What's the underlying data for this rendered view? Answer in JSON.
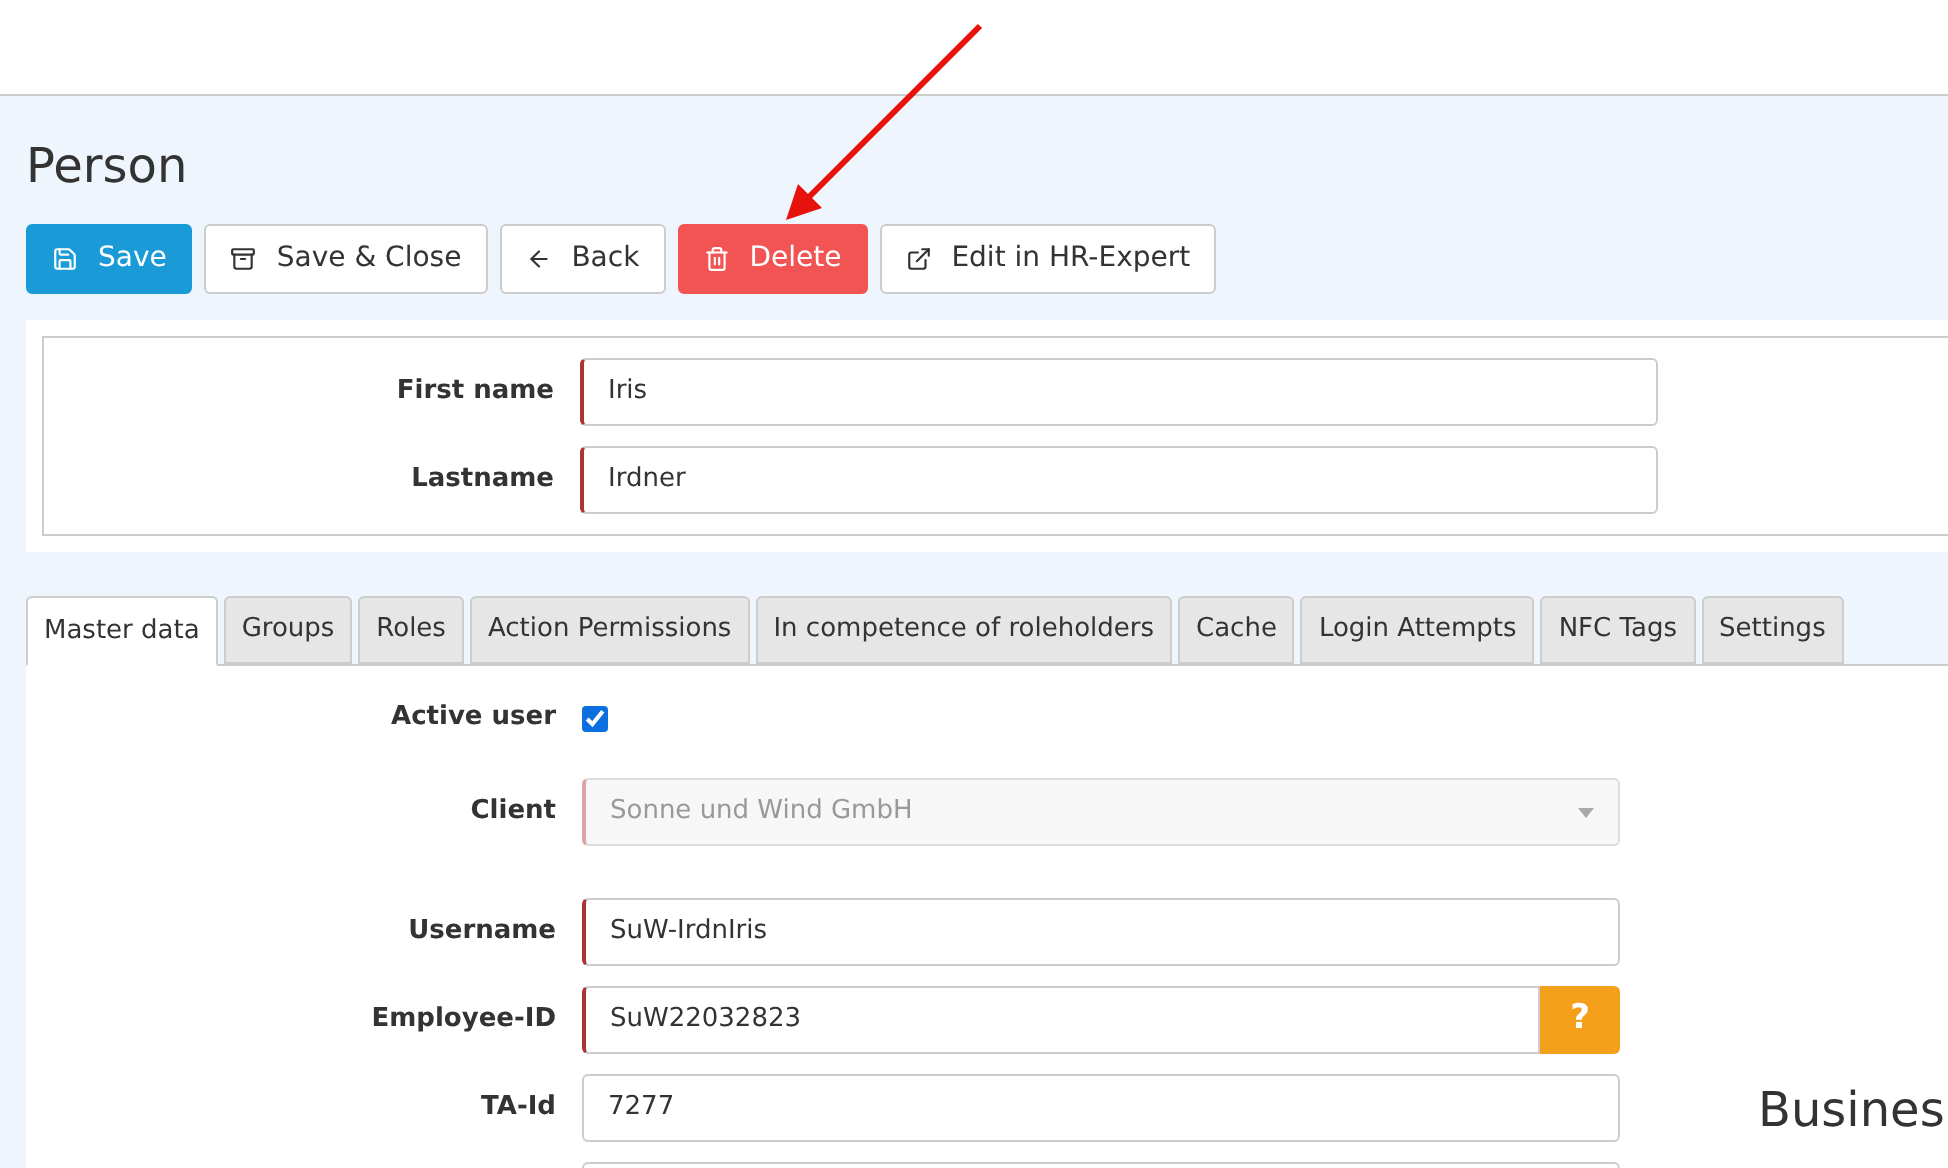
{
  "page": {
    "title": "Person"
  },
  "toolbar": [
    {
      "label": "Save",
      "kind": "primary"
    },
    {
      "label": "Save & Close",
      "kind": "archive"
    },
    {
      "label": "Back",
      "kind": "back"
    },
    {
      "label": "Delete",
      "kind": "danger"
    },
    {
      "label": "Edit in HR-Expert",
      "kind": "external"
    }
  ],
  "name_fields": [
    {
      "label": "First name",
      "value": "Iris",
      "required": true
    },
    {
      "label": "Lastname",
      "value": "Irdner",
      "required": true
    }
  ],
  "tabs": [
    {
      "label": "Master data",
      "selected": true
    },
    {
      "label": "Groups",
      "selected": false
    },
    {
      "label": "Roles",
      "selected": false
    },
    {
      "label": "Action Permissions",
      "selected": false
    },
    {
      "label": "In competence of roleholders",
      "selected": false
    },
    {
      "label": "Cache",
      "selected": false
    },
    {
      "label": "Login Attempts",
      "selected": false
    },
    {
      "label": "NFC Tags",
      "selected": false
    },
    {
      "label": "Settings",
      "selected": false
    }
  ],
  "master_data": [
    {
      "kind": "checkbox",
      "label": "Active user",
      "checked": true
    },
    {
      "kind": "select",
      "label": "Client",
      "value": "Sonne und Wind GmbH",
      "disabled": true,
      "required": true
    },
    {
      "kind": "text",
      "label": "Username",
      "value": "SuW-IrdnIris",
      "required": true
    },
    {
      "kind": "help",
      "label": "Employee-ID",
      "value": "SuW22032823",
      "required": true,
      "button": "?"
    },
    {
      "kind": "text",
      "label": "TA-Id",
      "value": "7277",
      "required": false
    },
    {
      "kind": "text",
      "required": false
    }
  ],
  "side_heading": "Busines"
}
